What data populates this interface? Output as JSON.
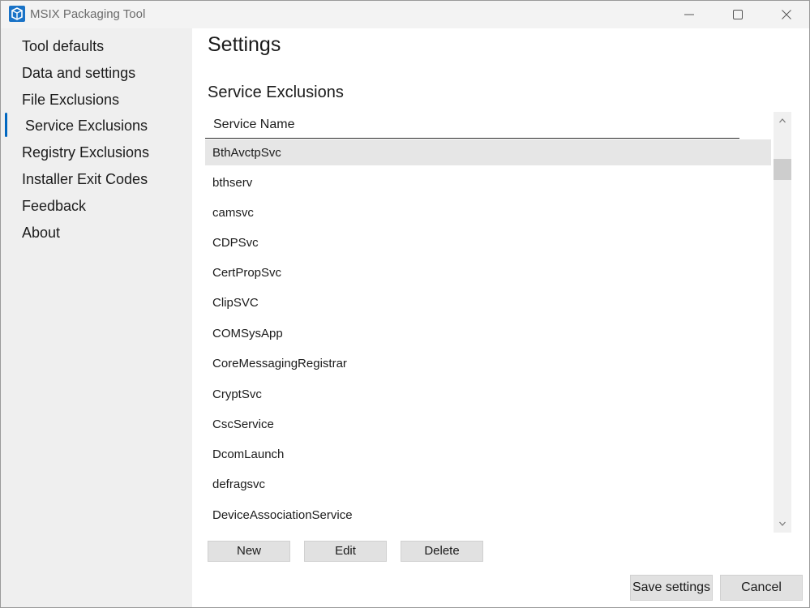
{
  "window": {
    "title": "MSIX Packaging Tool",
    "icon": "msix-app-icon"
  },
  "caption_buttons": {
    "minimize_icon": "minimize-icon",
    "maximize_icon": "maximize-icon",
    "close_icon": "close-icon"
  },
  "sidebar": {
    "items": [
      {
        "label": "Tool defaults"
      },
      {
        "label": "Data and settings"
      },
      {
        "label": "File Exclusions"
      },
      {
        "label": "Service Exclusions",
        "selected": true
      },
      {
        "label": "Registry Exclusions"
      },
      {
        "label": "Installer Exit Codes"
      },
      {
        "label": "Feedback"
      },
      {
        "label": "About"
      }
    ]
  },
  "main": {
    "title": "Settings",
    "section_title": "Service Exclusions",
    "list": {
      "column_header": "Service Name",
      "rows": [
        "BthAvctpSvc",
        "bthserv",
        "camsvc",
        "CDPSvc",
        "CertPropSvc",
        "ClipSVC",
        "COMSysApp",
        "CoreMessagingRegistrar",
        "CryptSvc",
        "CscService",
        "DcomLaunch",
        "defragsvc",
        "DeviceAssociationService"
      ],
      "selected_row": "BthAvctpSvc"
    },
    "buttons": {
      "new": "New",
      "edit": "Edit",
      "delete": "Delete"
    },
    "footer": {
      "save": "Save settings",
      "cancel": "Cancel"
    }
  },
  "colors": {
    "accent": "#0067c0",
    "sidebar_bg": "#efefef",
    "selected_row": "#e6e6e6",
    "button_bg": "#e1e1e1"
  }
}
